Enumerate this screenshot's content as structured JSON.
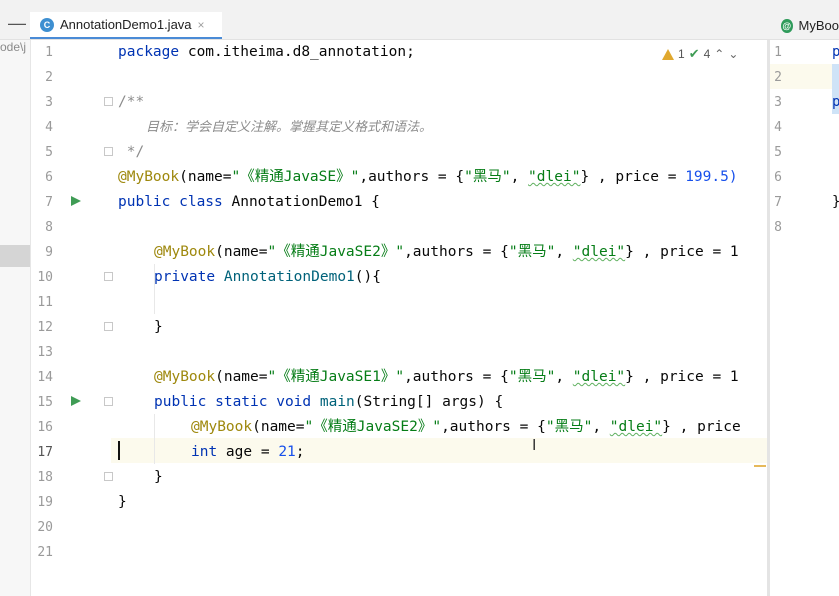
{
  "tabs": {
    "main_label": "AnnotationDemo1.java",
    "main_icon": "java-class-icon",
    "close_symbol": "×",
    "right_label": "MyBoo"
  },
  "project": {
    "path_fragment": "ode\\j"
  },
  "inspection": {
    "warnings": "1",
    "checks": "4"
  },
  "editor": {
    "line_numbers": [
      "1",
      "2",
      "3",
      "4",
      "5",
      "6",
      "7",
      "8",
      "9",
      "10",
      "11",
      "12",
      "13",
      "14",
      "15",
      "16",
      "17",
      "18",
      "19",
      "20",
      "21"
    ],
    "current_line": "17"
  },
  "code": {
    "l1_kw": "package",
    "l1_rest": " com.itheima.d8_annotation;",
    "l3": "/**",
    "l4": "目标：学会自定义注解。掌握其定义格式和语法。",
    "l5": " */",
    "ann": "@MyBook",
    "l6_name": "(name=",
    "l6_str": "\"《精通JavaSE》\"",
    "authors": ",authors = {",
    "heima": "\"黑马\"",
    "comma": ", ",
    "dlei": "\"dlei\"",
    "price_eq": "} , price = ",
    "l6_price": "199.5)",
    "l7_kw": "public class",
    "l7_rest": " AnnotationDemo1 {",
    "l9_str": "\"《精通JavaSE2》\"",
    "price_cut": "} , price = 1",
    "l10_kw": "private",
    "l10_fn": " AnnotationDemo1",
    "l10_rest": "(){",
    "brace_close": "}",
    "l14_str": "\"《精通JavaSE1》\"",
    "l15_kw": "public static void",
    "l15_fn": " main",
    "l15_rest": "(String[] args) {",
    "l16_str": "\"《精通JavaSE2》\"",
    "l16_price": "} , price",
    "l17_kw": "int",
    "l17_rest": " age = ",
    "l17_num": "21",
    "l17_end": ";"
  },
  "right_pane": {
    "line_numbers": [
      "1",
      "2",
      "3",
      "4",
      "5",
      "6",
      "7",
      "8"
    ],
    "l1": "p",
    "l3": "p",
    "l7": "}"
  }
}
